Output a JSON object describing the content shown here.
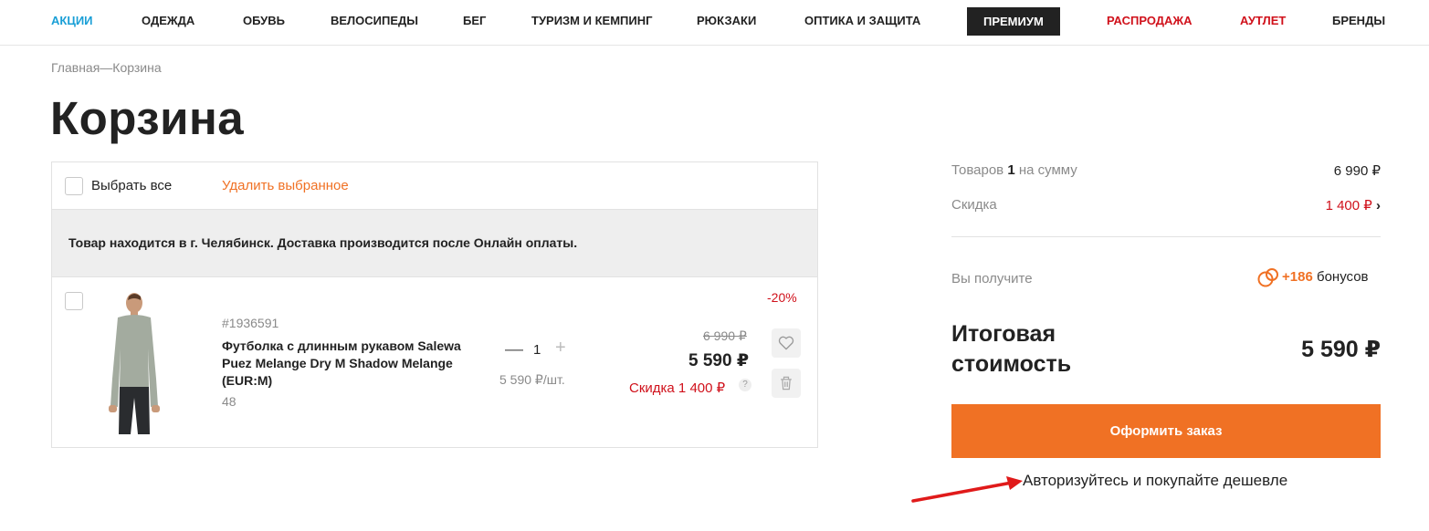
{
  "nav": {
    "items": [
      {
        "label": "АКЦИИ"
      },
      {
        "label": "ОДЕЖДА"
      },
      {
        "label": "ОБУВЬ"
      },
      {
        "label": "ВЕЛОСИПЕДЫ"
      },
      {
        "label": "БЕГ"
      },
      {
        "label": "ТУРИЗМ И КЕМПИНГ"
      },
      {
        "label": "РЮКЗАКИ"
      },
      {
        "label": "ОПТИКА И ЗАЩИТА"
      },
      {
        "label": "ПРЕМИУМ"
      },
      {
        "label": "РАСПРОДАЖА"
      },
      {
        "label": "АУТЛЕТ"
      },
      {
        "label": "БРЕНДЫ"
      }
    ]
  },
  "breadcrumb": {
    "home": "Главная",
    "separator": "—",
    "current": "Корзина"
  },
  "page": {
    "title": "Корзина"
  },
  "cart": {
    "select_all_label": "Выбрать все",
    "delete_selected_label": "Удалить выбранное",
    "notice": "Товар находится в г. Челябинск. Доставка производится после Онлайн оплаты.",
    "item": {
      "sku": "#1936591",
      "name": "Футболка с длинным рукавом Salewa Puez Melange Dry M Shadow Melange (EUR:M)",
      "size": "48",
      "quantity": "1",
      "unit_price": "5 590 ₽/шт.",
      "discount_badge": "-20%",
      "old_price": "6 990 ₽",
      "price": "5 590 ₽",
      "discount_text": "Скидка 1 400 ₽",
      "help_mark": "?"
    }
  },
  "summary": {
    "items_prefix": "Товаров",
    "items_count": "1",
    "items_suffix": "на сумму",
    "items_total": "6 990 ₽",
    "discount_label": "Скидка",
    "discount_value": "1 400 ₽",
    "bonus_label": "Вы получите",
    "bonus_amount": "+186",
    "bonus_word": "бонусов",
    "total_label": "Итоговая стоимость",
    "total_value": "5 590 ₽",
    "order_button": "Оформить заказ",
    "auth_link": "Авторизуйтесь и покупайте дешевле"
  },
  "colors": {
    "accent": "#f07124",
    "sale_red": "#d0111b",
    "nav_blue": "#1a9fd6",
    "premium_bg": "#222222"
  }
}
